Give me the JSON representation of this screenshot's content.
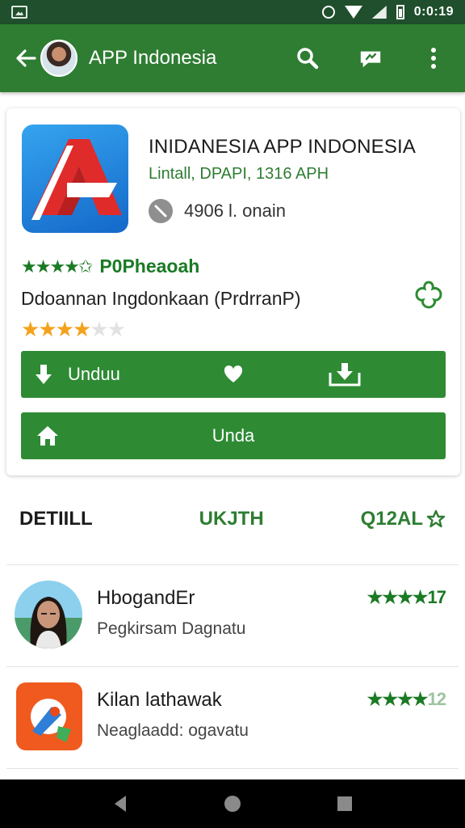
{
  "status_bar": {
    "time": "0:0:19"
  },
  "app_bar": {
    "title": "APP Indonesia"
  },
  "app": {
    "name": "INIDANESIA APP INDONESIA",
    "developer": "Lintall, DPAPI, 1316 APH",
    "installs": "4906 l. onain",
    "rating_stars": "★★★★✩",
    "rating_label": "P0Pheaoah",
    "category": "Ddoannan Ingdonkaan (PrdrranP)",
    "user_rating": 4,
    "user_rating_max": 6
  },
  "buttons": {
    "primary": {
      "label": "Unduu"
    },
    "secondary": {
      "label": "Unda"
    }
  },
  "tabs": [
    {
      "label": "DETIILL"
    },
    {
      "label": "UKJTH"
    },
    {
      "label": "Q12AL"
    }
  ],
  "list": [
    {
      "title": "HbogandEr",
      "subtitle": "Pegkirsam Dagnatu",
      "rating_stars": "★★★★",
      "rating_count": "17"
    },
    {
      "title": "Kilan lathawak",
      "subtitle": "Neaglaadd: ogavatu",
      "rating_stars": "★★★★",
      "rating_count": "12"
    }
  ],
  "colors": {
    "status_bar": "#1f4f2c",
    "app_bar": "#2e7d32",
    "button": "#2e8b34",
    "star_green": "#1b7a24",
    "star_orange": "#f4a21b"
  }
}
